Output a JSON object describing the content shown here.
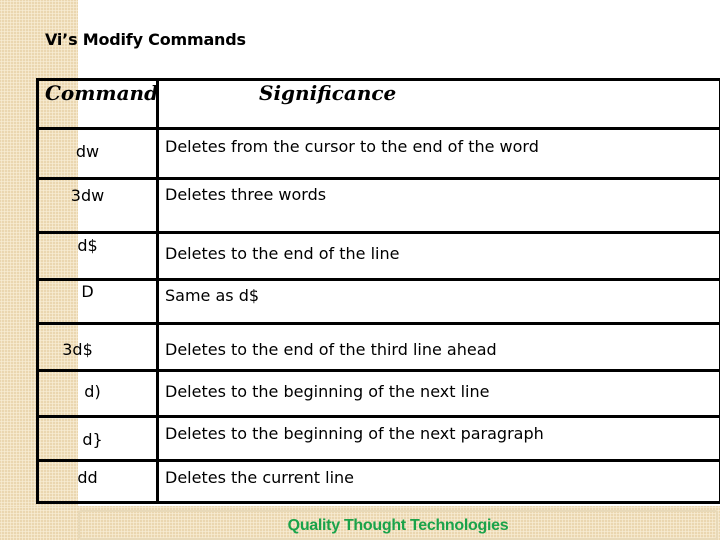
{
  "slide": {
    "title": "Vi’s Modify Commands",
    "footer": "Quality Thought Technologies",
    "footer_color": "#1aa34a"
  },
  "table": {
    "headers": {
      "command": "Command",
      "significance": "Significance"
    },
    "rows": [
      {
        "command": "dw",
        "significance": "Deletes from the cursor to the end of the word"
      },
      {
        "command": "3dw",
        "significance": "Deletes three words"
      },
      {
        "command": "d$",
        "significance": "Deletes to the end of the line"
      },
      {
        "command": "D",
        "significance": "Same as d$"
      },
      {
        "command": "3d$",
        "significance": "Deletes to the end of the third line ahead"
      },
      {
        "command": "d)",
        "significance": "Deletes to the beginning of the next line"
      },
      {
        "command": "d}",
        "significance": "Deletes to the beginning of the next paragraph"
      },
      {
        "command": "dd",
        "significance": "Deletes the current line"
      }
    ]
  }
}
